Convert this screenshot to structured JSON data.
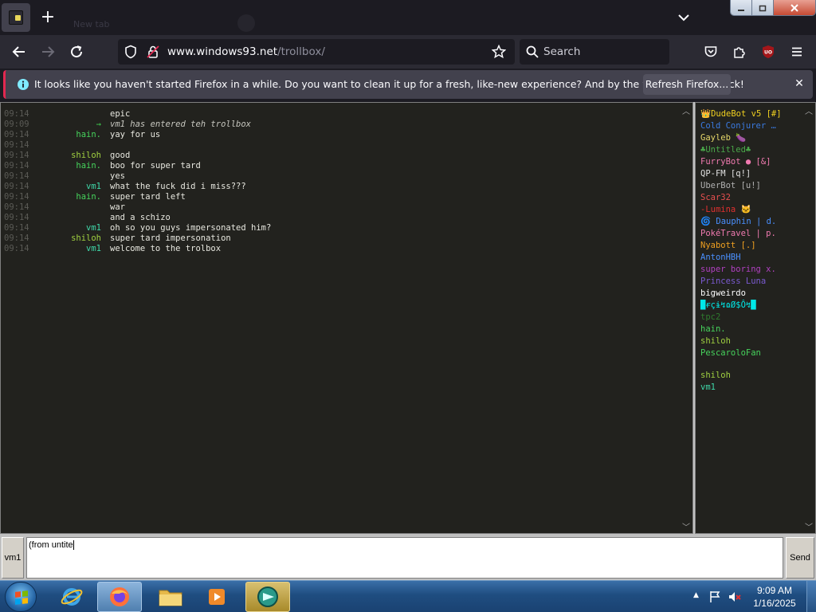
{
  "browser": {
    "ghost_tab_label": "New tab",
    "url_host": "www.windows93.net",
    "url_path": "/trollbox/",
    "search_placeholder": "Search",
    "accent_color": "#e22850"
  },
  "notification": {
    "message": "It looks like you haven't started Firefox in a while. Do you want to clean it up for a fresh, like-new experience? And by the way, welcome back!",
    "button_label": "Refresh Firefox...",
    "close_label": "✕"
  },
  "messages": [
    {
      "time": "09:14",
      "nick": "",
      "text": "epic",
      "nick_color": "#c0c0c0",
      "system": false
    },
    {
      "time": "09:09",
      "nick": "→",
      "text": "vm1 has entered teh trollbox",
      "nick_color": "#3fd04f",
      "system": true
    },
    {
      "time": "09:14",
      "nick": "hain.",
      "text": "yay for us",
      "nick_color": "#46d35c",
      "system": false
    },
    {
      "time": "09:14",
      "nick": "",
      "text": "",
      "nick_color": "#c0c0c0",
      "system": false
    },
    {
      "time": "09:14",
      "nick": "shiloh",
      "text": "good",
      "nick_color": "#a0d040",
      "system": false
    },
    {
      "time": "09:14",
      "nick": "hain.",
      "text": "boo for super tard",
      "nick_color": "#46d35c",
      "system": false
    },
    {
      "time": "09:14",
      "nick": "",
      "text": "yes",
      "nick_color": "#c0c0c0",
      "system": false
    },
    {
      "time": "09:14",
      "nick": "vm1",
      "text": "what the fuck did i miss???",
      "nick_color": "#3fd7a8",
      "system": false
    },
    {
      "time": "09:14",
      "nick": "hain.",
      "text": "super tard left",
      "nick_color": "#46d35c",
      "system": false
    },
    {
      "time": "09:14",
      "nick": "",
      "text": "war",
      "nick_color": "#c0c0c0",
      "system": false
    },
    {
      "time": "09:14",
      "nick": "",
      "text": "and a schizo",
      "nick_color": "#c0c0c0",
      "system": false
    },
    {
      "time": "09:14",
      "nick": "vm1",
      "text": "oh so you guys impersonated him?",
      "nick_color": "#3fd7a8",
      "system": false
    },
    {
      "time": "09:14",
      "nick": "shiloh",
      "text": "super tard impersonation",
      "nick_color": "#a0d040",
      "system": false
    },
    {
      "time": "09:14",
      "nick": "vm1",
      "text": "welcome to the trolbox",
      "nick_color": "#3fd7a8",
      "system": false
    }
  ],
  "users": [
    {
      "name": "👑DudeBot v5 [#]",
      "color": "#f0d020"
    },
    {
      "name": "Cold Conjurer …",
      "color": "#3a7ae0"
    },
    {
      "name": "Gayleb 🍆",
      "color": "#e6d86a"
    },
    {
      "name": "♣Untitled♣",
      "color": "#4aa84a"
    },
    {
      "name": "FurryBot ● [&]",
      "color": "#f07ab0"
    },
    {
      "name": "QP-FM [q!]",
      "color": "#e0e0e0"
    },
    {
      "name": "UberBot [u!]",
      "color": "#b0b0b0"
    },
    {
      "name": "Scar32",
      "color": "#e85050"
    },
    {
      "name": "-Lumina 🐱",
      "color": "#e03030"
    },
    {
      "name": "🌀 Dauphin | d.",
      "color": "#4a90ff"
    },
    {
      "name": "PokéTravel | p.",
      "color": "#f07ab0"
    },
    {
      "name": "Nyabott [.]",
      "color": "#f0a020"
    },
    {
      "name": "AntonHBH",
      "color": "#4a90ff"
    },
    {
      "name": "super boring x.",
      "color": "#b040c0"
    },
    {
      "name": "Princess Luna",
      "color": "#7a5ad0"
    },
    {
      "name": "bigweirdo",
      "color": "#ffffff"
    },
    {
      "name": "█ɍçɨ↯ɷØ$Ô↯█",
      "color": "#00e8e8"
    },
    {
      "name": "tpc2",
      "color": "#2e7a2e"
    },
    {
      "name": "hain.",
      "color": "#46d35c"
    },
    {
      "name": "shiloh",
      "color": "#a0d040"
    },
    {
      "name": "PescaroloFan",
      "color": "#46d35c"
    },
    {
      "name": "",
      "color": "#000000"
    },
    {
      "name": "shiloh",
      "color": "#a0d040"
    },
    {
      "name": "vm1",
      "color": "#3fd7a8"
    }
  ],
  "input": {
    "nick_label": "vm1",
    "value": "(from untite",
    "send_label": "Send"
  },
  "taskbar": {
    "time": "9:09 AM",
    "date": "1/16/2025"
  }
}
